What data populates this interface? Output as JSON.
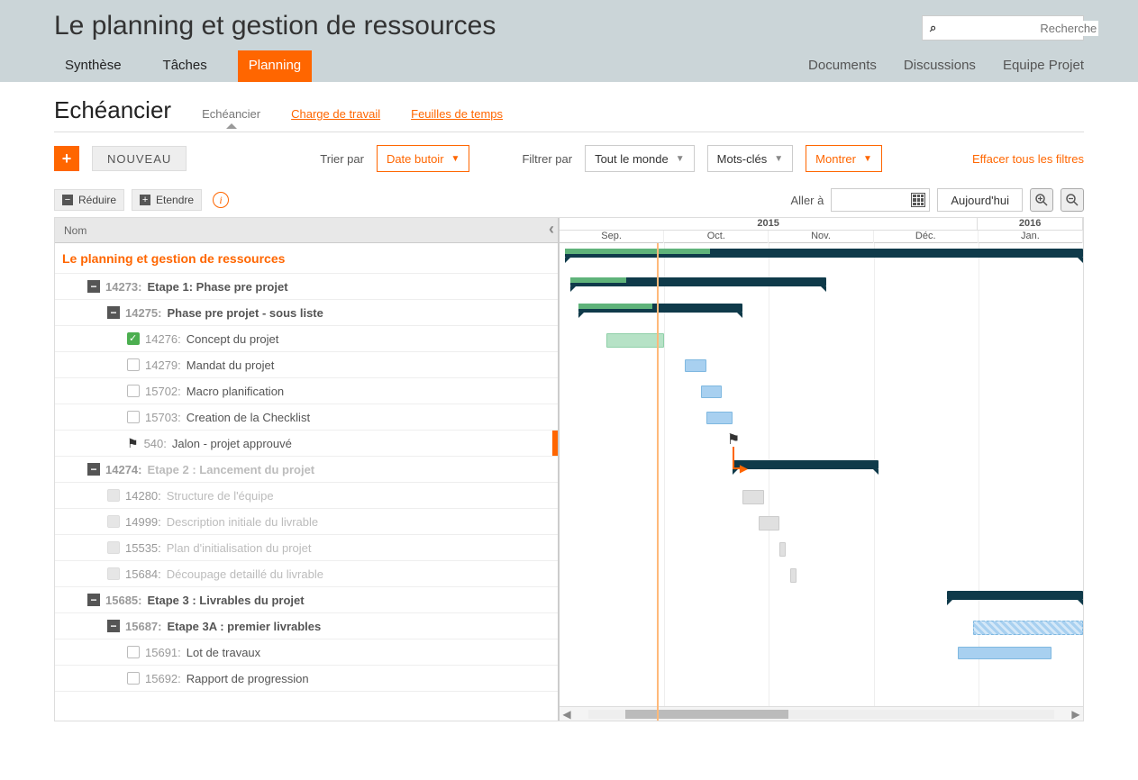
{
  "header": {
    "title": "Le planning et gestion de ressources",
    "search_placeholder": "Recherche",
    "tabs": [
      "Synthèse",
      "Tâches",
      "Planning"
    ],
    "active_tab": 2,
    "links": [
      "Documents",
      "Discussions",
      "Equipe Projet"
    ]
  },
  "sub": {
    "title": "Echéancier",
    "tabs": [
      {
        "label": "Echéancier",
        "active": true,
        "link": false
      },
      {
        "label": "Charge de travail",
        "active": false,
        "link": true
      },
      {
        "label": "Feuilles de temps",
        "active": false,
        "link": true
      }
    ],
    "new_button": "NOUVEAU",
    "sort_label": "Trier par",
    "sort_value": "Date butoir",
    "filter_label": "Filtrer par",
    "filter_value": "Tout le monde",
    "keywords": "Mots-clés",
    "show": "Montrer",
    "clear": "Effacer tous les filtres",
    "collapse": "Réduire",
    "expand": "Etendre",
    "goto": "Aller à",
    "today": "Aujourd'hui"
  },
  "tree": {
    "column": "Nom",
    "project": "Le planning et gestion de ressources",
    "rows": [
      {
        "l": 1,
        "type": "toggle",
        "id": "14273",
        "txt": "Etape 1: Phase pre projet",
        "bold": true
      },
      {
        "l": 2,
        "type": "toggle",
        "id": "14275",
        "txt": "Phase pre projet - sous liste",
        "bold": true
      },
      {
        "l": 3,
        "type": "done",
        "id": "14276",
        "txt": "Concept du projet"
      },
      {
        "l": 3,
        "type": "chk",
        "id": "14279",
        "txt": "Mandat du projet"
      },
      {
        "l": 3,
        "type": "chk",
        "id": "15702",
        "txt": "Macro planification"
      },
      {
        "l": 3,
        "type": "chk",
        "id": "15703",
        "txt": "Creation de la Checklist"
      },
      {
        "l": 3,
        "type": "flag",
        "id": "540",
        "txt": "Jalon - projet approuvé",
        "hl": true
      },
      {
        "l": 1,
        "type": "toggle",
        "id": "14274",
        "txt": "Etape 2 : Lancement du projet",
        "bold": true,
        "dim": true
      },
      {
        "l": 2,
        "type": "dim",
        "id": "14280",
        "txt": "Structure de l'équipe",
        "dim": true
      },
      {
        "l": 2,
        "type": "dim",
        "id": "14999",
        "txt": "Description initiale du livrable",
        "dim": true
      },
      {
        "l": 2,
        "type": "dim",
        "id": "15535",
        "txt": "Plan d'initialisation du projet",
        "dim": true
      },
      {
        "l": 2,
        "type": "dim",
        "id": "15684",
        "txt": "Découpage detaillé du livrable",
        "dim": true
      },
      {
        "l": 1,
        "type": "toggle",
        "id": "15685",
        "txt": "Etape 3 : Livrables du projet",
        "bold": true
      },
      {
        "l": 2,
        "type": "toggle",
        "id": "15687",
        "txt": "Etape 3A : premier livrables",
        "bold": true
      },
      {
        "l": 3,
        "type": "chk",
        "id": "15691",
        "txt": "Lot de travaux"
      },
      {
        "l": 3,
        "type": "chk",
        "id": "15692",
        "txt": "Rapport de progression"
      }
    ]
  },
  "timeline": {
    "years": [
      {
        "label": "2015",
        "span": 4
      },
      {
        "label": "2016",
        "span": 1
      }
    ],
    "months": [
      "Sep.",
      "Oct.",
      "Nov.",
      "Déc.",
      "Jan."
    ]
  },
  "chart_data": {
    "type": "gantt",
    "x_unit": "month",
    "x_range": [
      "2015-09",
      "2016-01"
    ],
    "today": "2015-09-28",
    "rows": [
      {
        "row": "project",
        "kind": "summary",
        "start": 0.05,
        "end": 5.0,
        "progress": 0.28
      },
      {
        "row": 0,
        "kind": "summary",
        "start": 0.1,
        "end": 2.55,
        "progress": 0.22
      },
      {
        "row": 1,
        "kind": "summary",
        "start": 0.18,
        "end": 1.75,
        "progress": 0.45
      },
      {
        "row": 2,
        "kind": "task",
        "cls": "green",
        "start": 0.45,
        "end": 1.0
      },
      {
        "row": 3,
        "kind": "task",
        "cls": "task",
        "start": 1.2,
        "end": 1.4
      },
      {
        "row": 4,
        "kind": "task",
        "cls": "task",
        "start": 1.35,
        "end": 1.55
      },
      {
        "row": 5,
        "kind": "task",
        "cls": "task",
        "start": 1.4,
        "end": 1.65
      },
      {
        "row": 6,
        "kind": "milestone",
        "at": 1.6
      },
      {
        "row": 7,
        "kind": "summary",
        "start": 1.65,
        "end": 3.05
      },
      {
        "row": 8,
        "kind": "task",
        "cls": "gray",
        "start": 1.75,
        "end": 1.95
      },
      {
        "row": 9,
        "kind": "task",
        "cls": "gray",
        "start": 1.9,
        "end": 2.1
      },
      {
        "row": 10,
        "kind": "task",
        "cls": "gray",
        "start": 2.1,
        "end": 2.16
      },
      {
        "row": 11,
        "kind": "task",
        "cls": "gray",
        "start": 2.2,
        "end": 2.26
      },
      {
        "row": 12,
        "kind": "summary",
        "start": 3.7,
        "end": 5.0
      },
      {
        "row": 13,
        "kind": "hatch",
        "start": 3.95,
        "end": 5.0
      },
      {
        "row": 14,
        "kind": "task",
        "cls": "task",
        "start": 3.8,
        "end": 4.7
      }
    ],
    "dependency": {
      "from_row": 6,
      "to_row": 7
    }
  }
}
